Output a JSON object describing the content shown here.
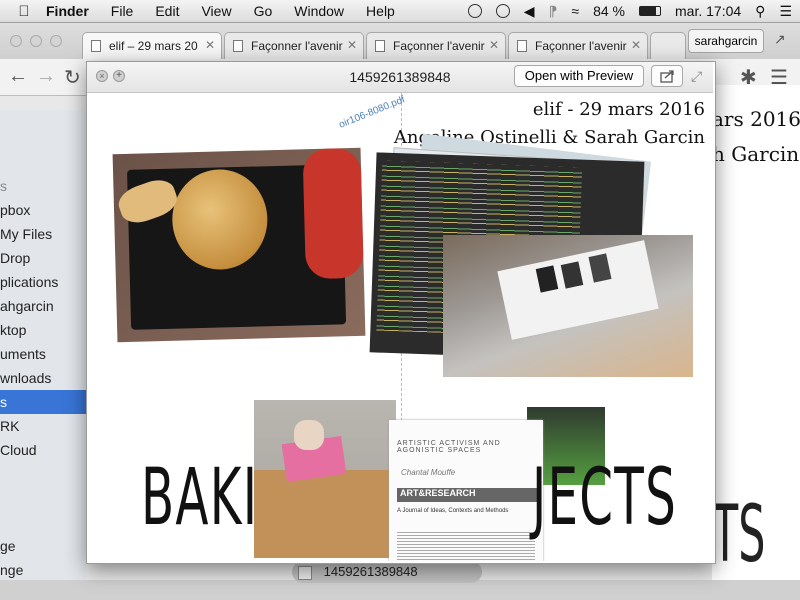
{
  "menubar": {
    "app_name": "Finder",
    "items": [
      "File",
      "Edit",
      "View",
      "Go",
      "Window",
      "Help"
    ],
    "battery": "84 %",
    "clock": "mar. 17:04"
  },
  "browser": {
    "tabs": [
      {
        "label": "elif – 29 mars 20"
      },
      {
        "label": "Façonner l'avenir"
      },
      {
        "label": "Façonner l'avenir"
      },
      {
        "label": "Façonner l'avenir"
      }
    ],
    "user_button": "sarahgarcin"
  },
  "sidebar": {
    "items": [
      "s",
      "pbox",
      "My Files",
      "Drop",
      "plications",
      "ahgarcin",
      "ktop",
      "uments",
      "wnloads",
      "s",
      "RK",
      "Cloud",
      "ge",
      "nge"
    ]
  },
  "background_page": {
    "title_line1": "ars 2016",
    "title_line2": "h Garcin",
    "big_letters": "TS"
  },
  "download": {
    "filename": "1459261389848"
  },
  "quicklook": {
    "title": "1459261389848",
    "open_button": "Open with Preview",
    "file_link": "oir106-8080.pdf",
    "header_line1": "elif - 29 mars 2016",
    "header_line2": "Angeline Ostinelli & Sarah Garcin",
    "big_text_left": "BAKI",
    "big_text_right": "JECTS",
    "paper": {
      "title": "ARTISTIC ACTIVISM AND AGONISTIC SPACES",
      "author": "Chantal Mouffe",
      "journal": "ART&RESEARCH",
      "subtitle": "A Journal of Ideas, Contexts and Methods"
    }
  },
  "colors": {
    "selection": "#3875d7",
    "link": "#4a7fc0"
  }
}
